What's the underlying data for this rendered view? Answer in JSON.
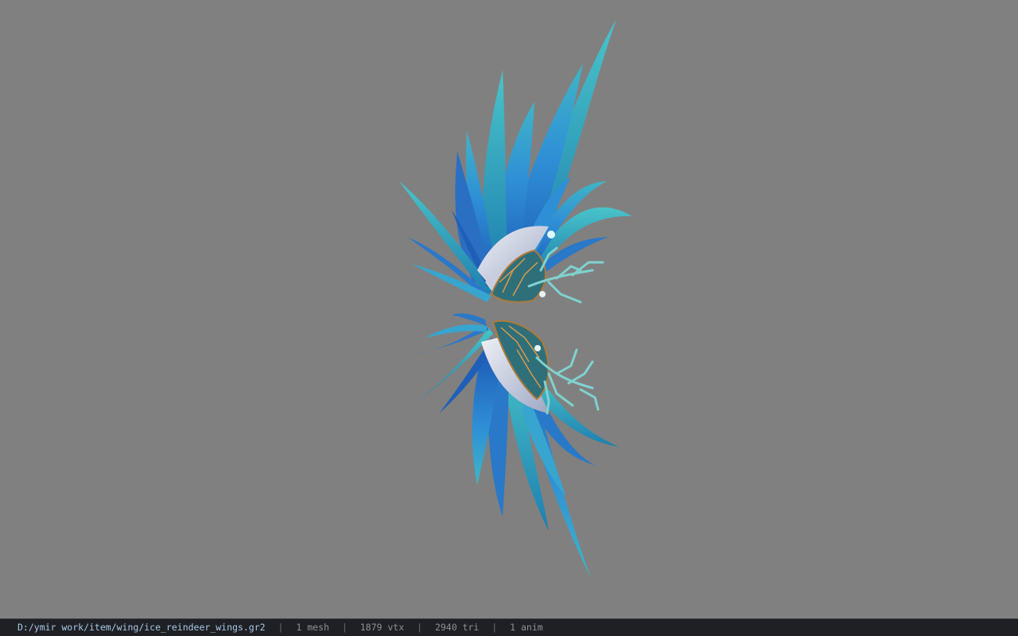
{
  "viewport": {
    "background_color": "#808080",
    "model": {
      "asset": "ice_reindeer_wings",
      "primary_color": "#2a78c8",
      "secondary_color": "#37b0c9",
      "highlight_color": "#d8dde8",
      "branch_color": "#7fd2cf",
      "trim_color": "#b07a3a"
    }
  },
  "status_bar": {
    "file_path": "D:/ymir work/item/wing/ice_reindeer_wings.gr2",
    "separator": "|",
    "mesh_count": "1 mesh",
    "vertex_count": "1879 vtx",
    "triangle_count": "2940 tri",
    "anim_count": "1 anim"
  }
}
